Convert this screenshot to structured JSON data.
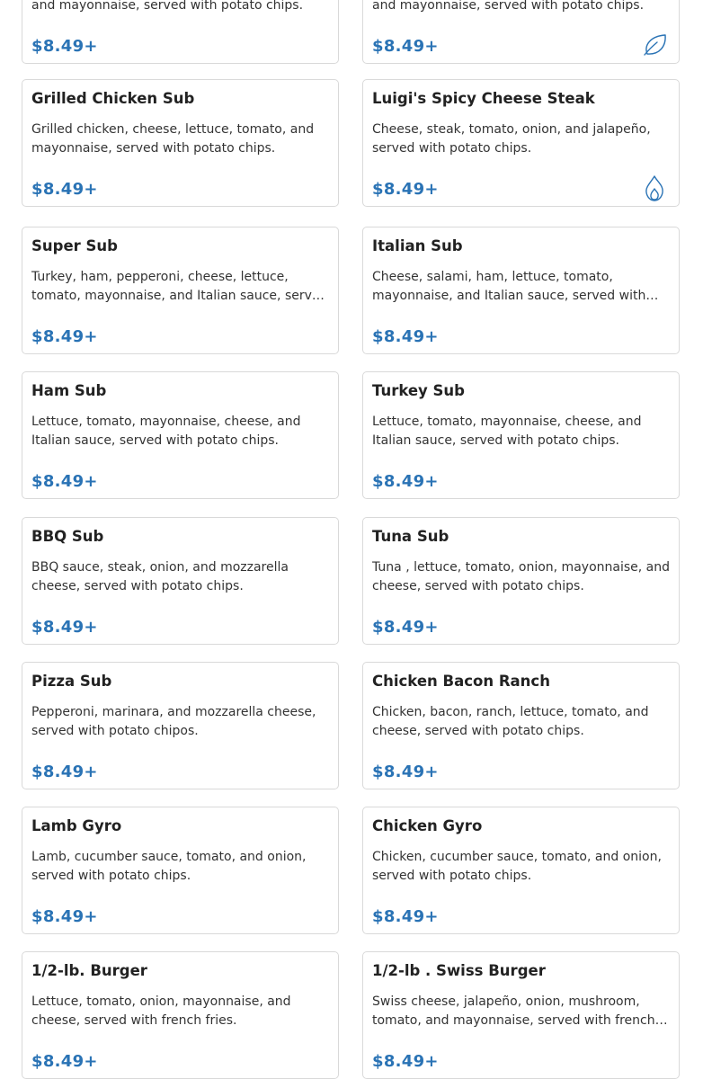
{
  "accent_color": "#2a73b5",
  "menu_items": [
    {
      "title": "",
      "description": "mushrooms, banana pepper, lettuce, tomato, and mayonnaise, served with potato chips.",
      "price": "$8.49+",
      "icon": ""
    },
    {
      "title": "",
      "description": "onion, black olives, broccoli, lettuce, tomato, and mayonnaise, served with potato chips.",
      "price": "$8.49+",
      "icon": "leaf-icon"
    },
    {
      "title": "Grilled Chicken Sub",
      "description": "Grilled chicken, cheese, lettuce, tomato, and mayonnaise, served with potato chips.",
      "price": "$8.49+",
      "icon": ""
    },
    {
      "title": "Luigi's Spicy Cheese Steak",
      "description": "Cheese, steak, tomato, onion, and jalapeño, served with potato chips.",
      "price": "$8.49+",
      "icon": "flame-icon"
    },
    {
      "title": "Super Sub",
      "description": "Turkey, ham, pepperoni, cheese, lettuce, tomato, mayonnaise, and Italian sauce, served with potato chips.",
      "price": "$8.49+",
      "icon": ""
    },
    {
      "title": "Italian Sub",
      "description": "Cheese, salami, ham, lettuce, tomato, mayonnaise, and Italian sauce, served with potato chips.",
      "price": "$8.49+",
      "icon": ""
    },
    {
      "title": "Ham Sub",
      "description": "Lettuce, tomato, mayonnaise, cheese, and Italian sauce, served with potato chips.",
      "price": "$8.49+",
      "icon": ""
    },
    {
      "title": "Turkey Sub",
      "description": "Lettuce, tomato, mayonnaise, cheese, and Italian sauce, served with potato chips.",
      "price": "$8.49+",
      "icon": ""
    },
    {
      "title": "BBQ Sub",
      "description": "BBQ sauce, steak, onion, and mozzarella cheese, served with potato chips.",
      "price": "$8.49+",
      "icon": ""
    },
    {
      "title": "Tuna Sub",
      "description": "Tuna , lettuce, tomato, onion, mayonnaise, and cheese, served with potato chips.",
      "price": "$8.49+",
      "icon": ""
    },
    {
      "title": "Pizza Sub",
      "description": "Pepperoni, marinara, and mozzarella cheese, served with potato chipos.",
      "price": "$8.49+",
      "icon": ""
    },
    {
      "title": "Chicken Bacon Ranch",
      "description": "Chicken, bacon, ranch, lettuce, tomato, and cheese, served with potato chips.",
      "price": "$8.49+",
      "icon": ""
    },
    {
      "title": "Lamb Gyro",
      "description": "Lamb, cucumber sauce, tomato, and onion, served with potato chips.",
      "price": "$8.49+",
      "icon": ""
    },
    {
      "title": "Chicken Gyro",
      "description": "Chicken, cucumber sauce, tomato, and onion, served with potato chips.",
      "price": "$8.49+",
      "icon": ""
    },
    {
      "title": "1/2-lb. Burger",
      "description": "Lettuce, tomato, onion, mayonnaise, and cheese, served with french fries.",
      "price": "$8.49+",
      "icon": ""
    },
    {
      "title": "1/2-lb . Swiss Burger",
      "description": "Swiss cheese, jalapeño, onion, mushroom, tomato, and mayonnaise, served with french fries.",
      "price": "$8.49+",
      "icon": ""
    }
  ]
}
